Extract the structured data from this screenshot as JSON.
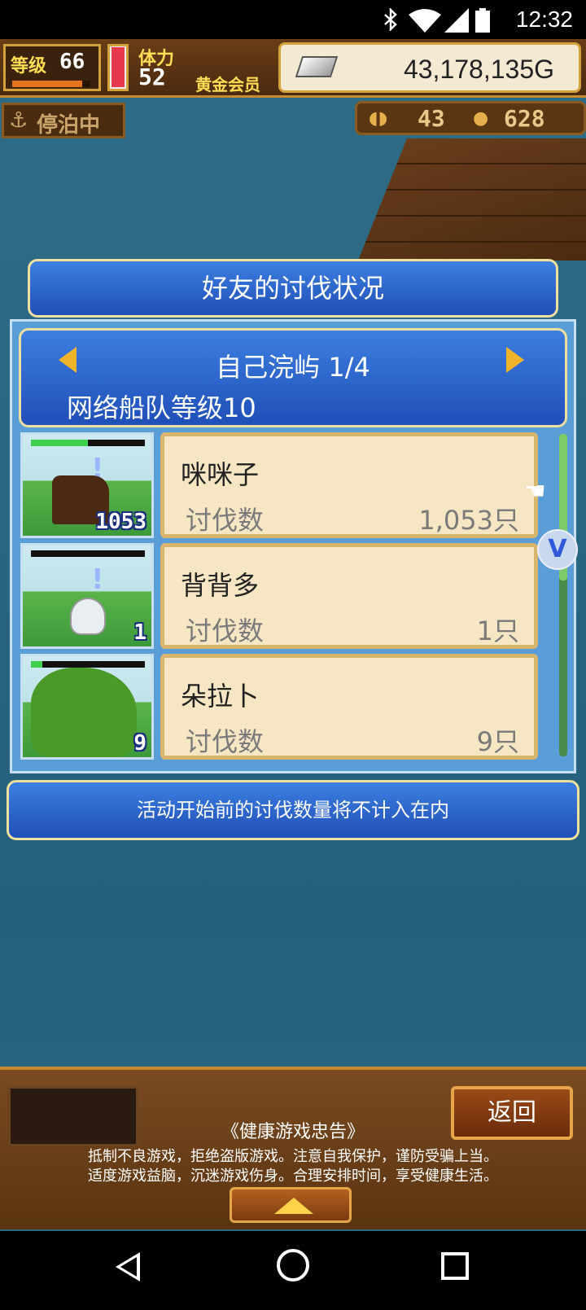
{
  "status_bar": {
    "time": "12:32",
    "icons": [
      "bluetooth-icon",
      "wifi-icon",
      "signal-icon",
      "battery-icon"
    ]
  },
  "hud": {
    "level_label": "等级",
    "level_value": "66",
    "level_progress": 0.9,
    "stamina_label": "体力",
    "stamina_value": "52",
    "stamina_fill": 0.95,
    "membership": "黄金会员",
    "gold_amount": "43,178,135G",
    "dock_status": "停泊中",
    "resource_1": "43",
    "resource_2": "628"
  },
  "dialog": {
    "title": "好友的讨伐状况",
    "header_title": "自己浣屿 1/4",
    "header_sub": "网络船队等级10",
    "rows": [
      {
        "name": "咪咪子",
        "label": "讨伐数",
        "value": "1,053只",
        "badge": "1053",
        "hp": 0.5,
        "monster_color": "#4a2a12"
      },
      {
        "name": "背背多",
        "label": "讨伐数",
        "value": "1只",
        "badge": "1",
        "hp": 0.0,
        "monster_color": "#e8eef2"
      },
      {
        "name": "朵拉卜",
        "label": "讨伐数",
        "value": "9只",
        "badge": "9",
        "hp": 0.1,
        "monster_color": "#4a9a2a"
      }
    ],
    "notice": "活动开始前的讨伐数量将不计入在内"
  },
  "bottom": {
    "back_label": "返回",
    "health_title": "《健康游戏忠告》",
    "health_line_1": "抵制不良游戏，拒绝盗版游戏。注意自我保护，谨防受骗上当。",
    "health_line_2": "适度游戏益脑，沉迷游戏伤身。合理安排时间，享受健康生活。"
  },
  "colors": {
    "panel_blue": "#1f4fb8",
    "card_cream": "#f6e6c4",
    "gold_border": "#d8b66e",
    "sea": "#2a6b86"
  }
}
